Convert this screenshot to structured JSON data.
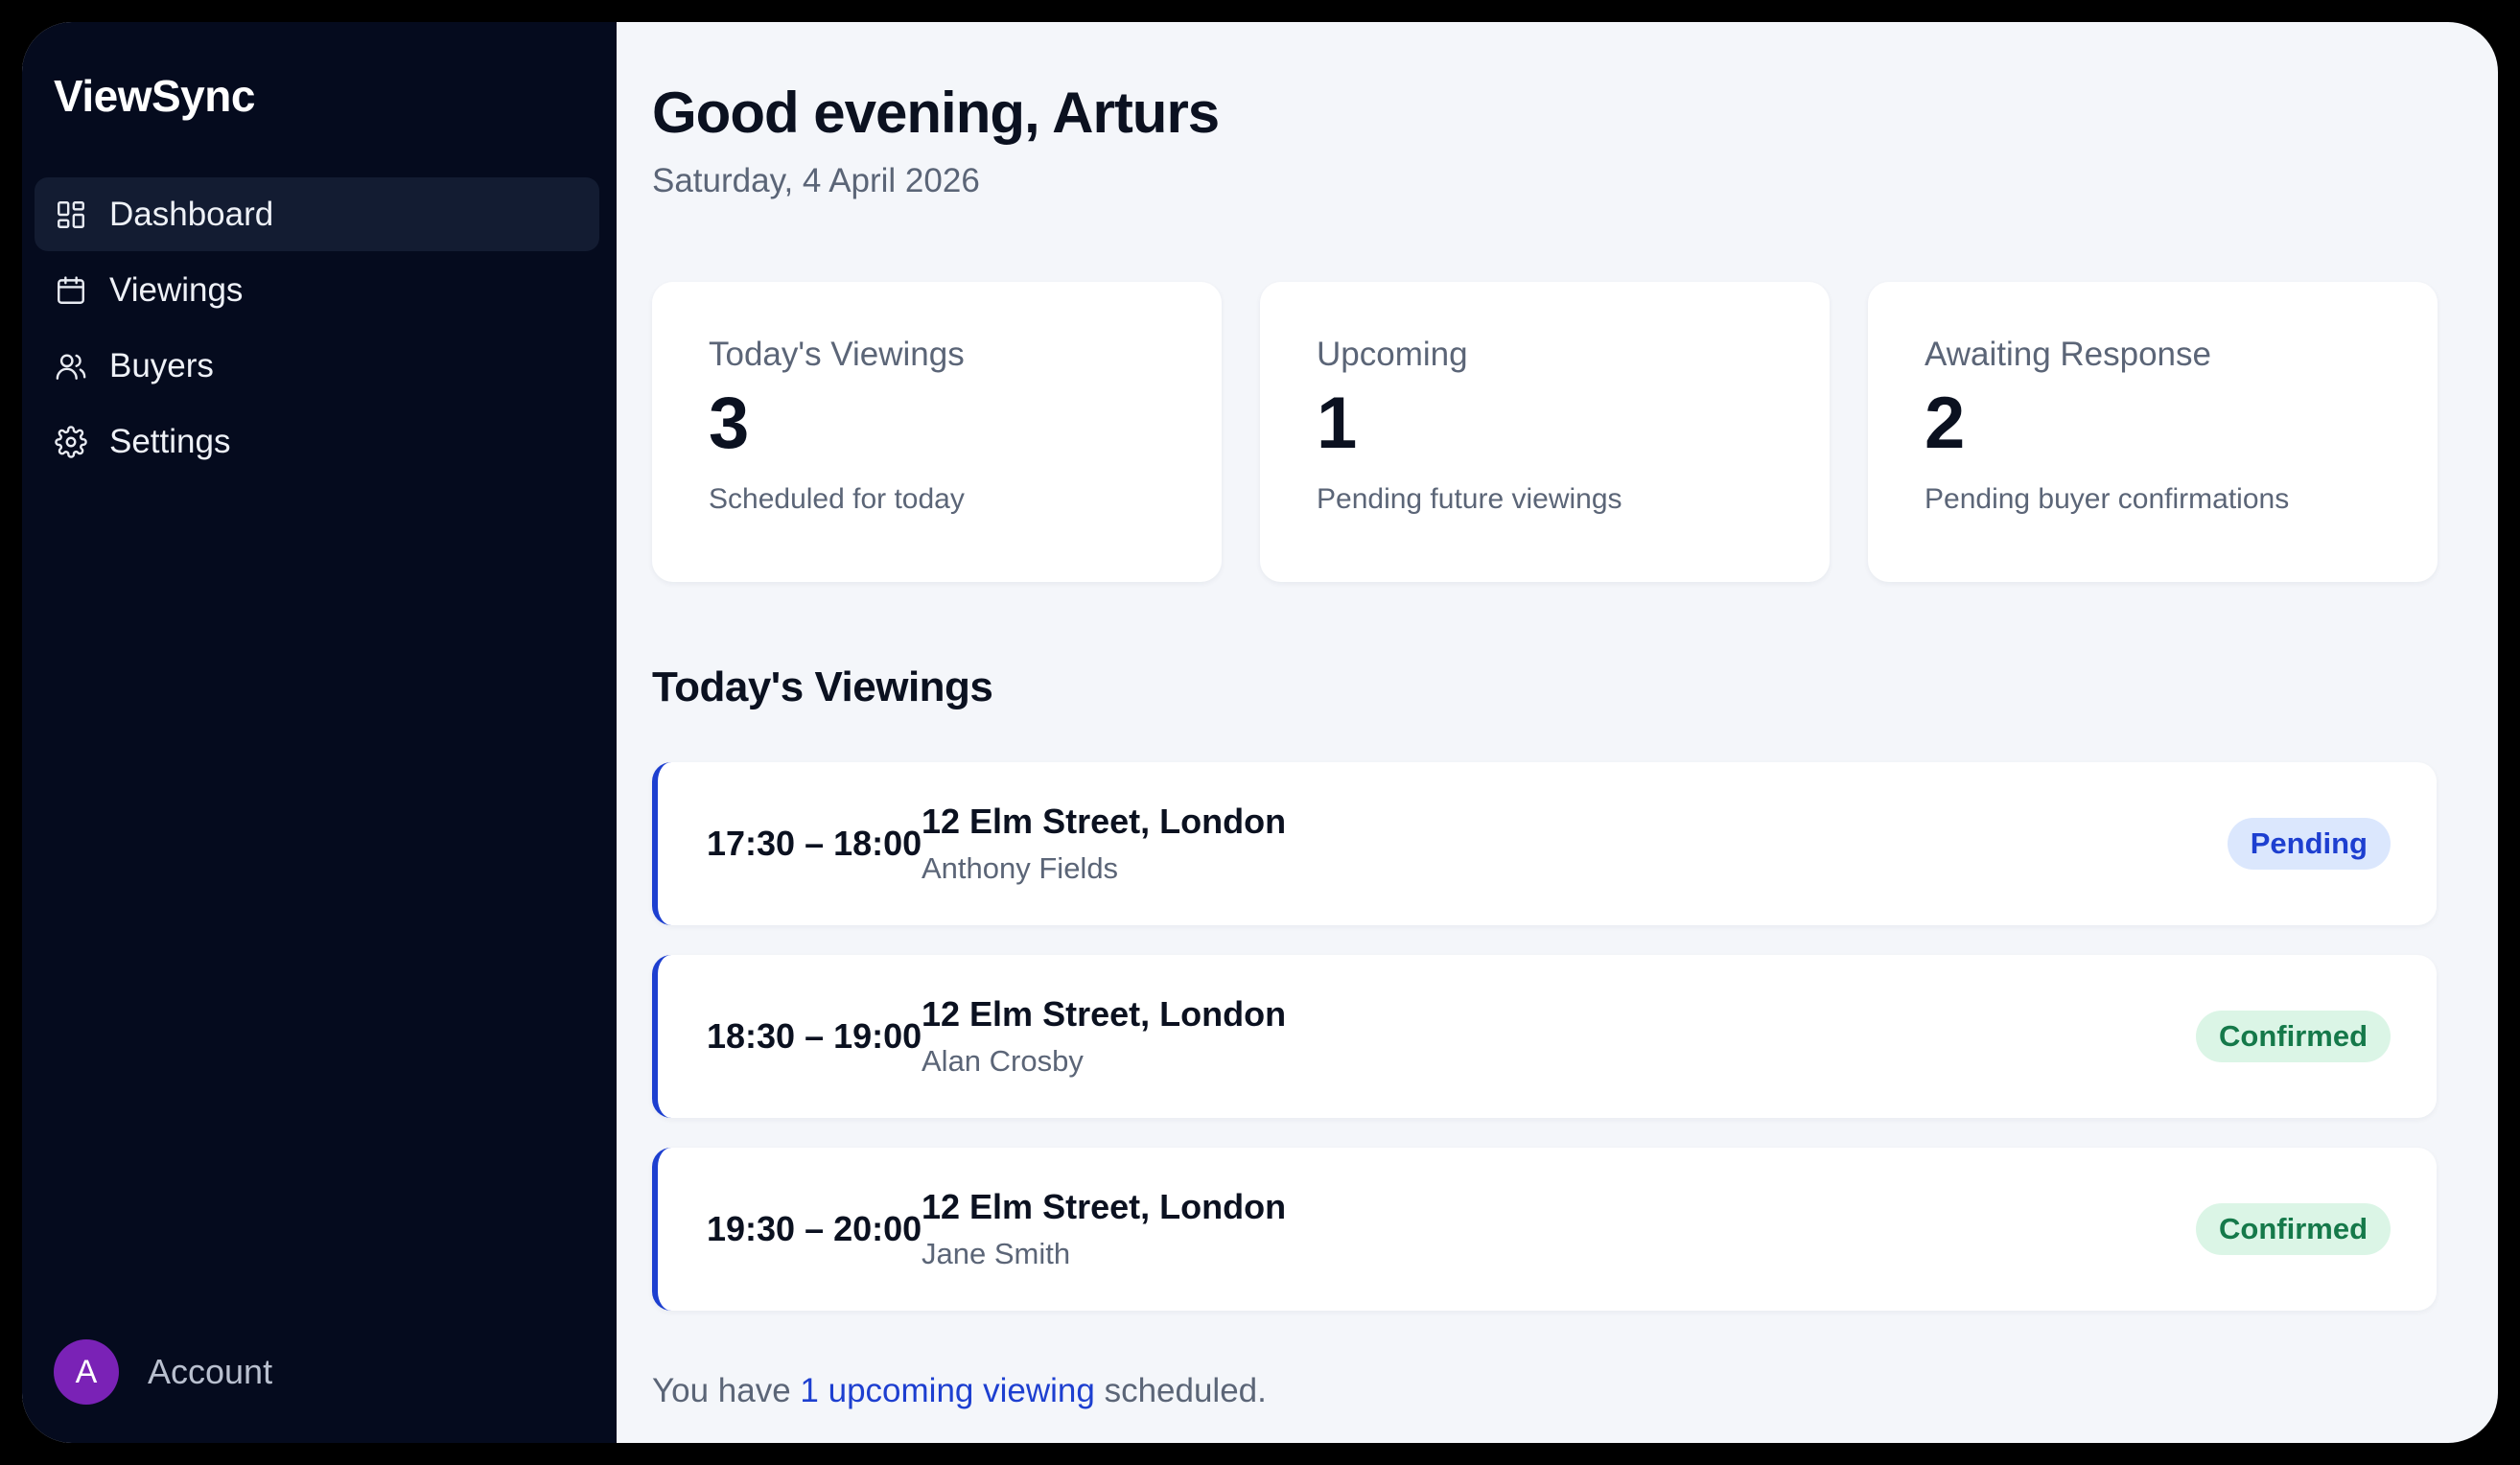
{
  "app": {
    "name": "ViewSync"
  },
  "sidebar": {
    "items": [
      {
        "label": "Dashboard",
        "icon": "dashboard-icon",
        "active": true
      },
      {
        "label": "Viewings",
        "icon": "calendar-icon",
        "active": false
      },
      {
        "label": "Buyers",
        "icon": "users-icon",
        "active": false
      },
      {
        "label": "Settings",
        "icon": "gear-icon",
        "active": false
      }
    ],
    "account": {
      "initial": "A",
      "label": "Account",
      "avatar_color": "#7a22b6"
    }
  },
  "header": {
    "greeting": "Good evening, Arturs",
    "date": "Saturday, 4 April 2026"
  },
  "stats": [
    {
      "title": "Today's Viewings",
      "value": "3",
      "subtitle": "Scheduled for today"
    },
    {
      "title": "Upcoming",
      "value": "1",
      "subtitle": "Pending future viewings"
    },
    {
      "title": "Awaiting Response",
      "value": "2",
      "subtitle": "Pending buyer confirmations"
    }
  ],
  "todays_viewings": {
    "title": "Today's Viewings",
    "items": [
      {
        "time": "17:30 – 18:00",
        "address": "12 Elm Street, London",
        "buyer": "Anthony Fields",
        "status": "Pending"
      },
      {
        "time": "18:30 – 19:00",
        "address": "12 Elm Street, London",
        "buyer": "Alan Crosby",
        "status": "Confirmed"
      },
      {
        "time": "19:30 – 20:00",
        "address": "12 Elm Street, London",
        "buyer": "Jane Smith",
        "status": "Confirmed"
      }
    ]
  },
  "footer": {
    "prefix": "You have",
    "link": "1 upcoming viewing",
    "suffix": "scheduled."
  },
  "colors": {
    "sidebar_bg": "#050b1e",
    "accent": "#1d3fd0",
    "pending_bg": "#dbe7fd",
    "confirmed_bg": "#dbf5e6",
    "confirmed_text": "#15794a"
  }
}
